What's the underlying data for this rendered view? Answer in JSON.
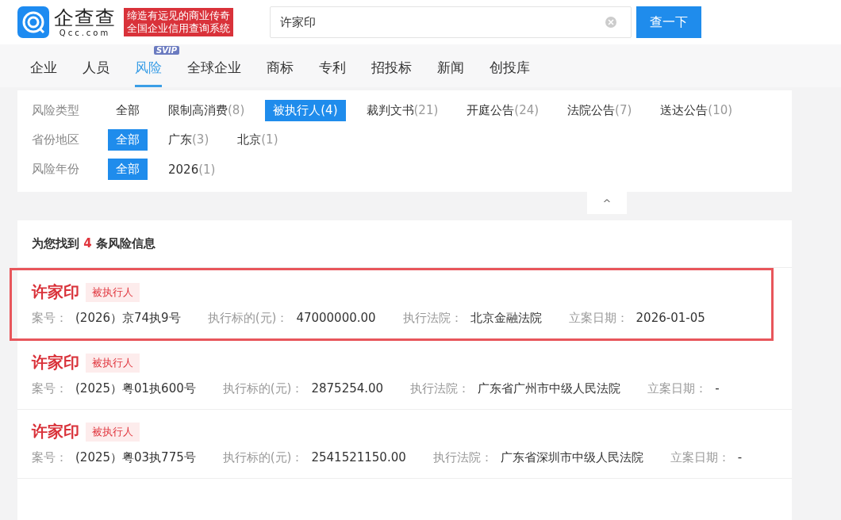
{
  "header": {
    "logo": {
      "name": "企查查",
      "domain": "Qcc.com"
    },
    "slogan": [
      "缔造有远见的商业传奇",
      "全国企业信用查询系统"
    ],
    "search": {
      "value": "许家印"
    },
    "search_button": "查一下"
  },
  "nav": [
    {
      "label": "企业",
      "selected": false
    },
    {
      "label": "人员",
      "selected": false
    },
    {
      "label": "风险",
      "selected": true,
      "badge": "SVIP"
    },
    {
      "label": "全球企业",
      "selected": false
    },
    {
      "label": "商标",
      "selected": false
    },
    {
      "label": "专利",
      "selected": false
    },
    {
      "label": "招投标",
      "selected": false
    },
    {
      "label": "新闻",
      "selected": false
    },
    {
      "label": "创投库",
      "selected": false
    }
  ],
  "filters": [
    {
      "label": "风险类型",
      "options": [
        {
          "text": "全部",
          "selected": false
        },
        {
          "text": "限制高消费",
          "count": "(8)",
          "selected": false
        },
        {
          "text": "被执行人",
          "count": "(4)",
          "selected": true
        },
        {
          "text": "裁判文书",
          "count": "(21)",
          "selected": false
        },
        {
          "text": "开庭公告",
          "count": "(24)",
          "selected": false
        },
        {
          "text": "法院公告",
          "count": "(7)",
          "selected": false
        },
        {
          "text": "送达公告",
          "count": "(10)",
          "selected": false
        }
      ]
    },
    {
      "label": "省份地区",
      "options": [
        {
          "text": "全部",
          "selected": true
        },
        {
          "text": "广东",
          "count": "(3)",
          "selected": false
        },
        {
          "text": "北京",
          "count": "(1)",
          "selected": false
        }
      ]
    },
    {
      "label": "风险年份",
      "options": [
        {
          "text": "全部",
          "selected": true
        },
        {
          "text": "2026",
          "count": "(1)",
          "selected": false
        }
      ]
    }
  ],
  "collapse": "^",
  "summary": {
    "prefix": "为您找到",
    "count": "4",
    "suffix": "条风险信息"
  },
  "results": [
    {
      "name": "许家印",
      "tag": "被执行人",
      "highlighted": true,
      "fields": [
        {
          "label": "案号：",
          "value": "(2026）京74执9号"
        },
        {
          "label": "执行标的(元)：",
          "value": "47000000.00"
        },
        {
          "label": "执行法院：",
          "value": "北京金融法院"
        },
        {
          "label": "立案日期：",
          "value": "2026-01-05"
        }
      ]
    },
    {
      "name": "许家印",
      "tag": "被执行人",
      "highlighted": false,
      "fields": [
        {
          "label": "案号：",
          "value": "(2025）粤01执600号"
        },
        {
          "label": "执行标的(元)：",
          "value": "2875254.00"
        },
        {
          "label": "执行法院：",
          "value": "广东省广州市中级人民法院"
        },
        {
          "label": "立案日期：",
          "value": "-"
        }
      ]
    },
    {
      "name": "许家印",
      "tag": "被执行人",
      "highlighted": false,
      "fields": [
        {
          "label": "案号：",
          "value": "(2025）粤03执775号"
        },
        {
          "label": "执行标的(元)：",
          "value": "2541521150.00"
        },
        {
          "label": "执行法院：",
          "value": "广东省深圳市中级人民法院"
        },
        {
          "label": "立案日期：",
          "value": "-"
        }
      ]
    }
  ]
}
